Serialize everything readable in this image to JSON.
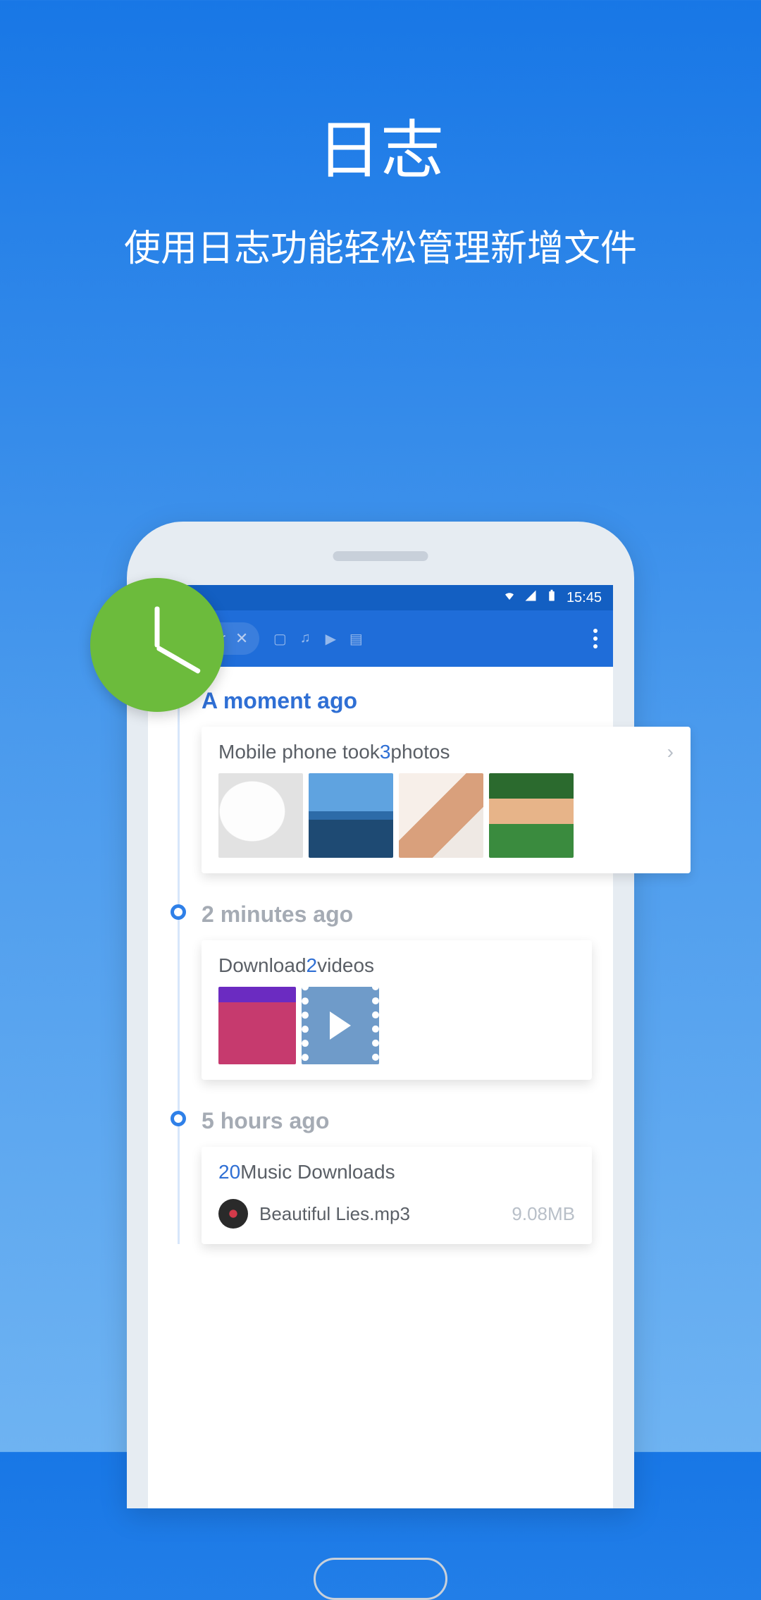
{
  "header": {
    "title": "日志",
    "subtitle": "使用日志功能轻松管理新增文件"
  },
  "statusbar": {
    "time": "15:45"
  },
  "toolbar": {
    "logger_label": "Logger"
  },
  "timeline": [
    {
      "time_label": "A moment ago",
      "color": "blue",
      "card": {
        "prefix": "Mobile phone took ",
        "count": "3",
        "suffix": " photos",
        "show_chevron": true
      }
    },
    {
      "time_label": "2 minutes ago",
      "color": "grey",
      "card": {
        "prefix": "Download ",
        "count": "2",
        "suffix": " videos",
        "show_chevron": false
      }
    },
    {
      "time_label": "5 hours ago",
      "color": "grey",
      "card": {
        "prefix": "",
        "count": "20",
        "suffix": " Music Downloads",
        "show_chevron": false,
        "music": {
          "name": "Beautiful Lies.mp3",
          "size": "9.08MB"
        }
      }
    }
  ]
}
